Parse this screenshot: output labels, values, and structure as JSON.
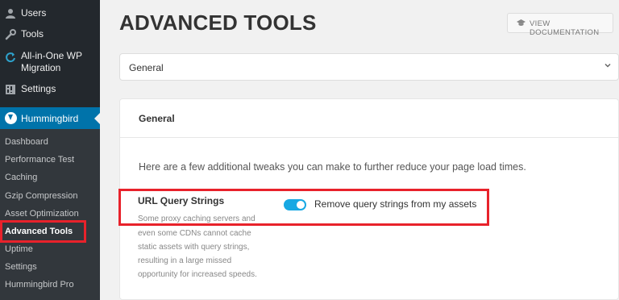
{
  "sidebar": {
    "items": [
      {
        "label": "Users",
        "icon": "user-icon"
      },
      {
        "label": "Tools",
        "icon": "wrench-icon"
      },
      {
        "label": "All-in-One WP Migration",
        "icon": "refresh-icon"
      },
      {
        "label": "Settings",
        "icon": "settings-icon"
      }
    ],
    "active_plugin": {
      "label": "Hummingbird",
      "icon": "hummingbird-icon"
    },
    "submenu": [
      {
        "label": "Dashboard"
      },
      {
        "label": "Performance Test"
      },
      {
        "label": "Caching"
      },
      {
        "label": "Gzip Compression"
      },
      {
        "label": "Asset Optimization"
      },
      {
        "label": "Advanced Tools"
      },
      {
        "label": "Uptime"
      },
      {
        "label": "Settings"
      },
      {
        "label": "Hummingbird Pro"
      }
    ],
    "active_submenu": "Advanced Tools"
  },
  "header": {
    "title": "ADVANCED TOOLS",
    "doc_button": {
      "label": "VIEW DOCUMENTATION",
      "icon": "graduation-cap-icon"
    }
  },
  "section_select": {
    "value": "General",
    "icon": "chevron-down-icon"
  },
  "panel": {
    "title": "General",
    "intro": "Here are a few additional tweaks you can make to further reduce your page load times.",
    "setting": {
      "title": "URL Query Strings",
      "description_lines": [
        "Some proxy caching servers and",
        "even some CDNs cannot cache",
        "static assets with query strings,",
        "resulting in a large missed",
        "opportunity for increased speeds."
      ],
      "toggle_on": true,
      "toggle_label": "Remove query strings from my assets"
    }
  },
  "colors": {
    "sidebar_bg": "#23282d",
    "submenu_bg": "#32373c",
    "active_blue": "#0073aa",
    "toggle_blue": "#17a8e3",
    "highlight_red": "#e8222b"
  }
}
